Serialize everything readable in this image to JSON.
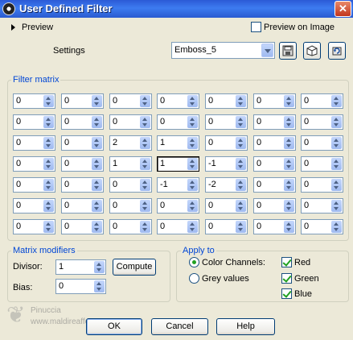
{
  "window": {
    "title": "User Defined Filter",
    "close_glyph": "✕"
  },
  "preview": {
    "label": "Preview",
    "on_image_label": "Preview on Image",
    "on_image_checked": false
  },
  "settings": {
    "label": "Settings",
    "selected": "Emboss_5",
    "tools": [
      "save-preset-icon",
      "randomize-icon",
      "reset-icon"
    ]
  },
  "filter_matrix": {
    "label": "Filter matrix",
    "rows": [
      [
        "0",
        "0",
        "0",
        "0",
        "0",
        "0",
        "0"
      ],
      [
        "0",
        "0",
        "0",
        "0",
        "0",
        "0",
        "0"
      ],
      [
        "0",
        "0",
        "2",
        "1",
        "0",
        "0",
        "0"
      ],
      [
        "0",
        "0",
        "1",
        "1",
        "-1",
        "0",
        "0"
      ],
      [
        "0",
        "0",
        "0",
        "-1",
        "-2",
        "0",
        "0"
      ],
      [
        "0",
        "0",
        "0",
        "0",
        "0",
        "0",
        "0"
      ],
      [
        "0",
        "0",
        "0",
        "0",
        "0",
        "0",
        "0"
      ]
    ],
    "focused_cell": [
      3,
      3
    ]
  },
  "modifiers": {
    "label": "Matrix modifiers",
    "divisor_label": "Divisor:",
    "divisor": "1",
    "compute_label": "Compute",
    "bias_label": "Bias:",
    "bias": "0"
  },
  "apply_to": {
    "label": "Apply to",
    "color_channels": "Color Channels:",
    "color_channels_selected": true,
    "grey_values": "Grey values",
    "red": "Red",
    "green": "Green",
    "blue": "Blue",
    "red_checked": true,
    "green_checked": true,
    "blue_checked": true
  },
  "buttons": {
    "ok": "OK",
    "cancel": "Cancel",
    "help": "Help"
  },
  "watermark": {
    "name": "Pinuccia",
    "site": "www.maldireaffe..."
  }
}
